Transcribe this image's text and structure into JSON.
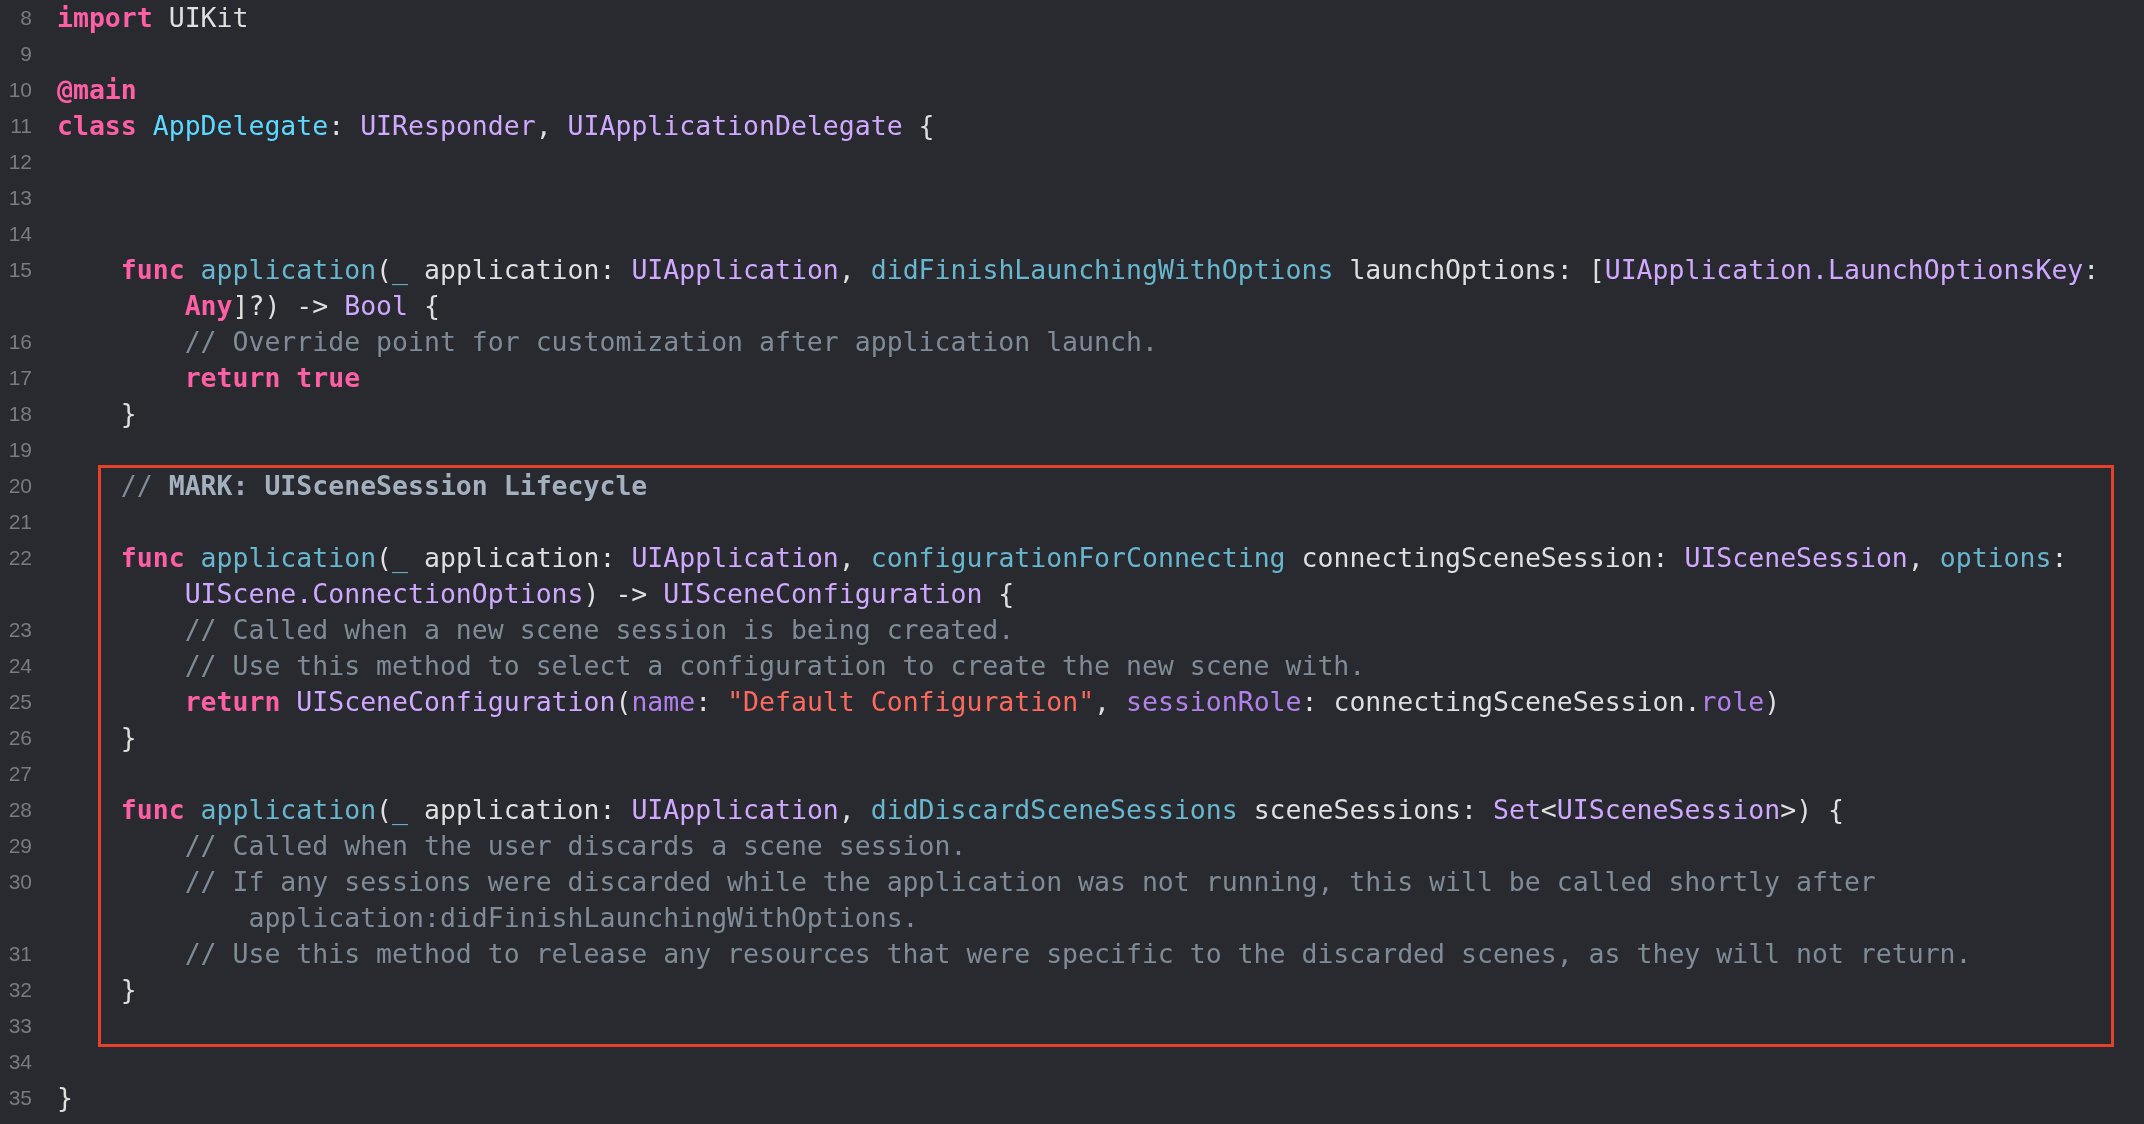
{
  "editor": {
    "blocks": [
      {
        "highlighted": false,
        "rows": [
          {
            "number": "8",
            "segments": [
              {
                "kind": "keyword",
                "text": "import"
              },
              {
                "kind": "plain",
                "text": " UIKit"
              }
            ]
          },
          {
            "number": "9"
          },
          {
            "number": "10",
            "segments": [
              {
                "kind": "attribute",
                "text": "@main"
              }
            ]
          },
          {
            "number": "11",
            "segments": [
              {
                "kind": "keyword",
                "text": "class"
              },
              {
                "kind": "declaration",
                "text": " AppDelegate"
              },
              {
                "kind": "plain",
                "text": ": "
              },
              {
                "kind": "type",
                "text": "UIResponder"
              },
              {
                "kind": "plain",
                "text": ", "
              },
              {
                "kind": "type",
                "text": "UIApplicationDelegate"
              },
              {
                "kind": "plain",
                "text": " {"
              }
            ]
          },
          {
            "number": "12"
          },
          {
            "number": "13"
          },
          {
            "number": "14"
          },
          {
            "number": "15",
            "segments": [
              {
                "kind": "keyword",
                "text": "    func"
              },
              {
                "kind": "name",
                "text": " application"
              },
              {
                "kind": "plain",
                "text": "("
              },
              {
                "kind": "name",
                "text": "_"
              },
              {
                "kind": "plain",
                "text": " application: "
              },
              {
                "kind": "type",
                "text": "UIApplication"
              },
              {
                "kind": "plain",
                "text": ", "
              },
              {
                "kind": "name",
                "text": "didFinishLaunchingWithOptions"
              },
              {
                "kind": "plain",
                "text": " launchOptions: ["
              },
              {
                "kind": "type",
                "text": "UIApplication.LaunchOptionsKey"
              },
              {
                "kind": "plain",
                "text": ":"
              }
            ]
          },
          {
            "segments": [
              {
                "kind": "keyword",
                "text": "        Any"
              },
              {
                "kind": "plain",
                "text": "]?) -> "
              },
              {
                "kind": "type",
                "text": "Bool"
              },
              {
                "kind": "plain",
                "text": " {"
              }
            ]
          },
          {
            "number": "16",
            "segments": [
              {
                "kind": "comment",
                "text": "        // Override point for customization after application launch."
              }
            ]
          },
          {
            "number": "17",
            "segments": [
              {
                "kind": "keyword",
                "text": "        return true"
              }
            ]
          },
          {
            "number": "18",
            "segments": [
              {
                "kind": "plain",
                "text": "    }"
              }
            ]
          },
          {
            "number": "19"
          }
        ]
      },
      {
        "highlighted": true,
        "rows": [
          {
            "number": "20",
            "segments": [
              {
                "kind": "comment",
                "text": "    //"
              },
              {
                "kind": "mark",
                "text": " MARK: UISceneSession Lifecycle"
              }
            ]
          },
          {
            "number": "21"
          },
          {
            "number": "22",
            "segments": [
              {
                "kind": "keyword",
                "text": "    func"
              },
              {
                "kind": "name",
                "text": " application"
              },
              {
                "kind": "plain",
                "text": "("
              },
              {
                "kind": "name",
                "text": "_"
              },
              {
                "kind": "plain",
                "text": " application: "
              },
              {
                "kind": "type",
                "text": "UIApplication"
              },
              {
                "kind": "plain",
                "text": ", "
              },
              {
                "kind": "name",
                "text": "configurationForConnecting"
              },
              {
                "kind": "plain",
                "text": " connectingSceneSession: "
              },
              {
                "kind": "type",
                "text": "UISceneSession"
              },
              {
                "kind": "plain",
                "text": ", "
              },
              {
                "kind": "name",
                "text": "options"
              },
              {
                "kind": "plain",
                "text": ":"
              }
            ]
          },
          {
            "segments": [
              {
                "kind": "type",
                "text": "        UIScene.ConnectionOptions"
              },
              {
                "kind": "plain",
                "text": ") -> "
              },
              {
                "kind": "type",
                "text": "UISceneConfiguration"
              },
              {
                "kind": "plain",
                "text": " {"
              }
            ]
          },
          {
            "number": "23",
            "segments": [
              {
                "kind": "comment",
                "text": "        // Called when a new scene session is being created."
              }
            ]
          },
          {
            "number": "24",
            "segments": [
              {
                "kind": "comment",
                "text": "        // Use this method to select a configuration to create the new scene with."
              }
            ]
          },
          {
            "number": "25",
            "segments": [
              {
                "kind": "keyword",
                "text": "        return"
              },
              {
                "kind": "type",
                "text": " UISceneConfiguration"
              },
              {
                "kind": "plain",
                "text": "("
              },
              {
                "kind": "label",
                "text": "name"
              },
              {
                "kind": "plain",
                "text": ": "
              },
              {
                "kind": "string",
                "text": "\"Default Configuration\""
              },
              {
                "kind": "plain",
                "text": ", "
              },
              {
                "kind": "label",
                "text": "sessionRole"
              },
              {
                "kind": "plain",
                "text": ": connectingSceneSession."
              },
              {
                "kind": "label",
                "text": "role"
              },
              {
                "kind": "plain",
                "text": ")"
              }
            ]
          },
          {
            "number": "26",
            "segments": [
              {
                "kind": "plain",
                "text": "    }"
              }
            ]
          },
          {
            "number": "27"
          },
          {
            "number": "28",
            "segments": [
              {
                "kind": "keyword",
                "text": "    func"
              },
              {
                "kind": "name",
                "text": " application"
              },
              {
                "kind": "plain",
                "text": "("
              },
              {
                "kind": "name",
                "text": "_"
              },
              {
                "kind": "plain",
                "text": " application: "
              },
              {
                "kind": "type",
                "text": "UIApplication"
              },
              {
                "kind": "plain",
                "text": ", "
              },
              {
                "kind": "name",
                "text": "didDiscardSceneSessions"
              },
              {
                "kind": "plain",
                "text": " sceneSessions: "
              },
              {
                "kind": "type",
                "text": "Set"
              },
              {
                "kind": "plain",
                "text": "<"
              },
              {
                "kind": "type",
                "text": "UISceneSession"
              },
              {
                "kind": "plain",
                "text": ">) {"
              }
            ]
          },
          {
            "number": "29",
            "segments": [
              {
                "kind": "comment",
                "text": "        // Called when the user discards a scene session."
              }
            ]
          },
          {
            "number": "30",
            "segments": [
              {
                "kind": "comment",
                "text": "        // If any sessions were discarded while the application was not running, this will be called shortly after"
              }
            ]
          },
          {
            "segments": [
              {
                "kind": "comment",
                "text": "            application:didFinishLaunchingWithOptions."
              }
            ]
          },
          {
            "number": "31",
            "segments": [
              {
                "kind": "comment",
                "text": "        // Use this method to release any resources that were specific to the discarded scenes, as they will not return."
              }
            ]
          },
          {
            "number": "32",
            "segments": [
              {
                "kind": "plain",
                "text": "    }"
              }
            ]
          },
          {
            "number": "33"
          }
        ]
      },
      {
        "highlighted": false,
        "rows": [
          {
            "number": "34"
          },
          {
            "number": "35",
            "segments": [
              {
                "kind": "plain",
                "text": "}"
              }
            ]
          }
        ]
      }
    ]
  }
}
